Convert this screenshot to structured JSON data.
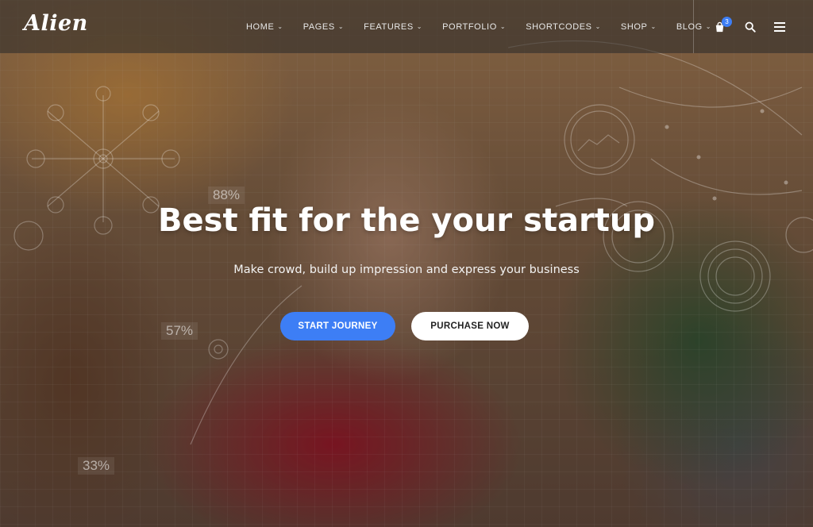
{
  "brand": {
    "logo_text": "Alien"
  },
  "nav": {
    "items": [
      {
        "label": "HOME"
      },
      {
        "label": "PAGES"
      },
      {
        "label": "FEATURES"
      },
      {
        "label": "PORTFOLIO"
      },
      {
        "label": "SHORTCODES"
      },
      {
        "label": "SHOP"
      },
      {
        "label": "BLOG"
      }
    ],
    "cart_count": "3",
    "icons": {
      "cart": "shopping-bag-icon",
      "search": "search-icon",
      "menu": "hamburger-menu-icon"
    }
  },
  "hero": {
    "headline": "Best fit for the your startup",
    "subheadline": "Make crowd, build up impression and express your business",
    "primary_button": "START JOURNEY",
    "secondary_button": "PURCHASE NOW"
  },
  "background_stats": [
    "88%",
    "57%",
    "33%"
  ],
  "colors": {
    "accent": "#3d7ef5",
    "nav_bg": "rgba(40,40,40,0.55)",
    "text": "#ffffff"
  }
}
